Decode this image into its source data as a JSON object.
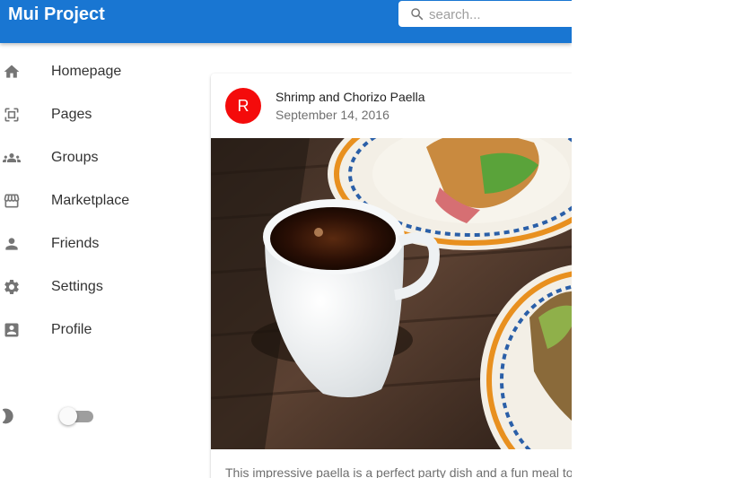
{
  "app": {
    "title": "Mui Project"
  },
  "search": {
    "placeholder": "search..."
  },
  "sidebar": {
    "items": [
      {
        "label": "Homepage",
        "icon": "home-icon"
      },
      {
        "label": "Pages",
        "icon": "pages-icon"
      },
      {
        "label": "Groups",
        "icon": "groups-icon"
      },
      {
        "label": "Marketplace",
        "icon": "storefront-icon"
      },
      {
        "label": "Friends",
        "icon": "person-icon"
      },
      {
        "label": "Settings",
        "icon": "gear-icon"
      },
      {
        "label": "Profile",
        "icon": "account-box-icon"
      }
    ],
    "theme_toggle": {
      "icon": "moon-icon",
      "checked": false
    }
  },
  "post": {
    "avatar_letter": "R",
    "title": "Shrimp and Chorizo Paella",
    "date": "September 14, 2016",
    "body": "This impressive paella is a perfect party dish and a fun meal to cook together with your guests.",
    "image_alt": "coffee cup and breakfast plates photo"
  },
  "colors": {
    "appbar": "#1976d2",
    "avatar": "#f40b0b",
    "icon": "#757575",
    "text": "#333333",
    "muted": "#707070"
  }
}
